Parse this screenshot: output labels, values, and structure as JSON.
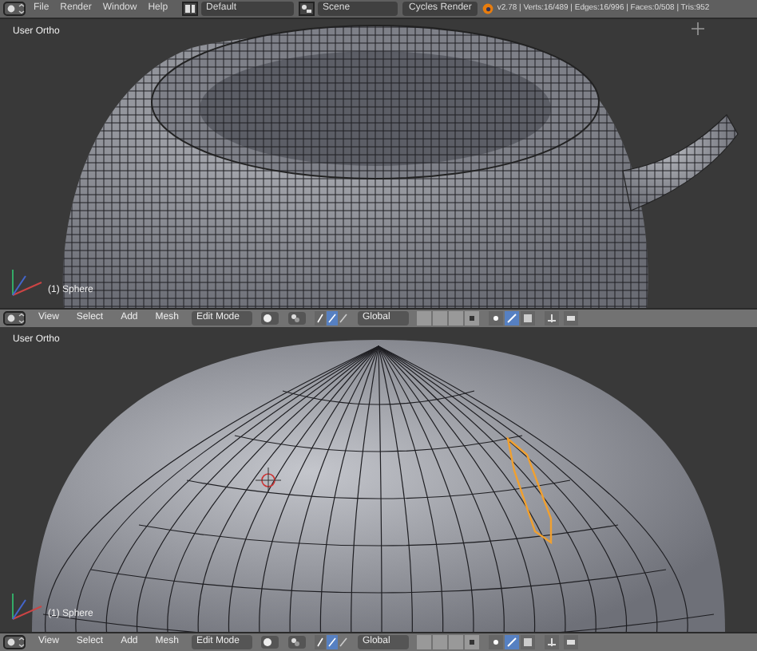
{
  "top_bar": {
    "menus": [
      "File",
      "Render",
      "Window",
      "Help"
    ],
    "layout": "Default",
    "scene": "Scene",
    "engine": "Cycles Render",
    "stats": "v2.78 | Verts:16/489 | Edges:16/996 | Faces:0/508 | Tris:952"
  },
  "viewports": [
    {
      "kind": "teapot",
      "view_label": "User Ortho",
      "object_label": "(1) Sphere",
      "header": {
        "menus": [
          "View",
          "Select",
          "Add",
          "Mesh"
        ],
        "mode": "Edit Mode",
        "orientation": "Global"
      }
    },
    {
      "kind": "sphere",
      "view_label": "User Ortho",
      "object_label": "(1) Sphere",
      "header": {
        "menus": [
          "View",
          "Select",
          "Add",
          "Mesh"
        ],
        "mode": "Edit Mode",
        "orientation": "Global"
      }
    }
  ]
}
